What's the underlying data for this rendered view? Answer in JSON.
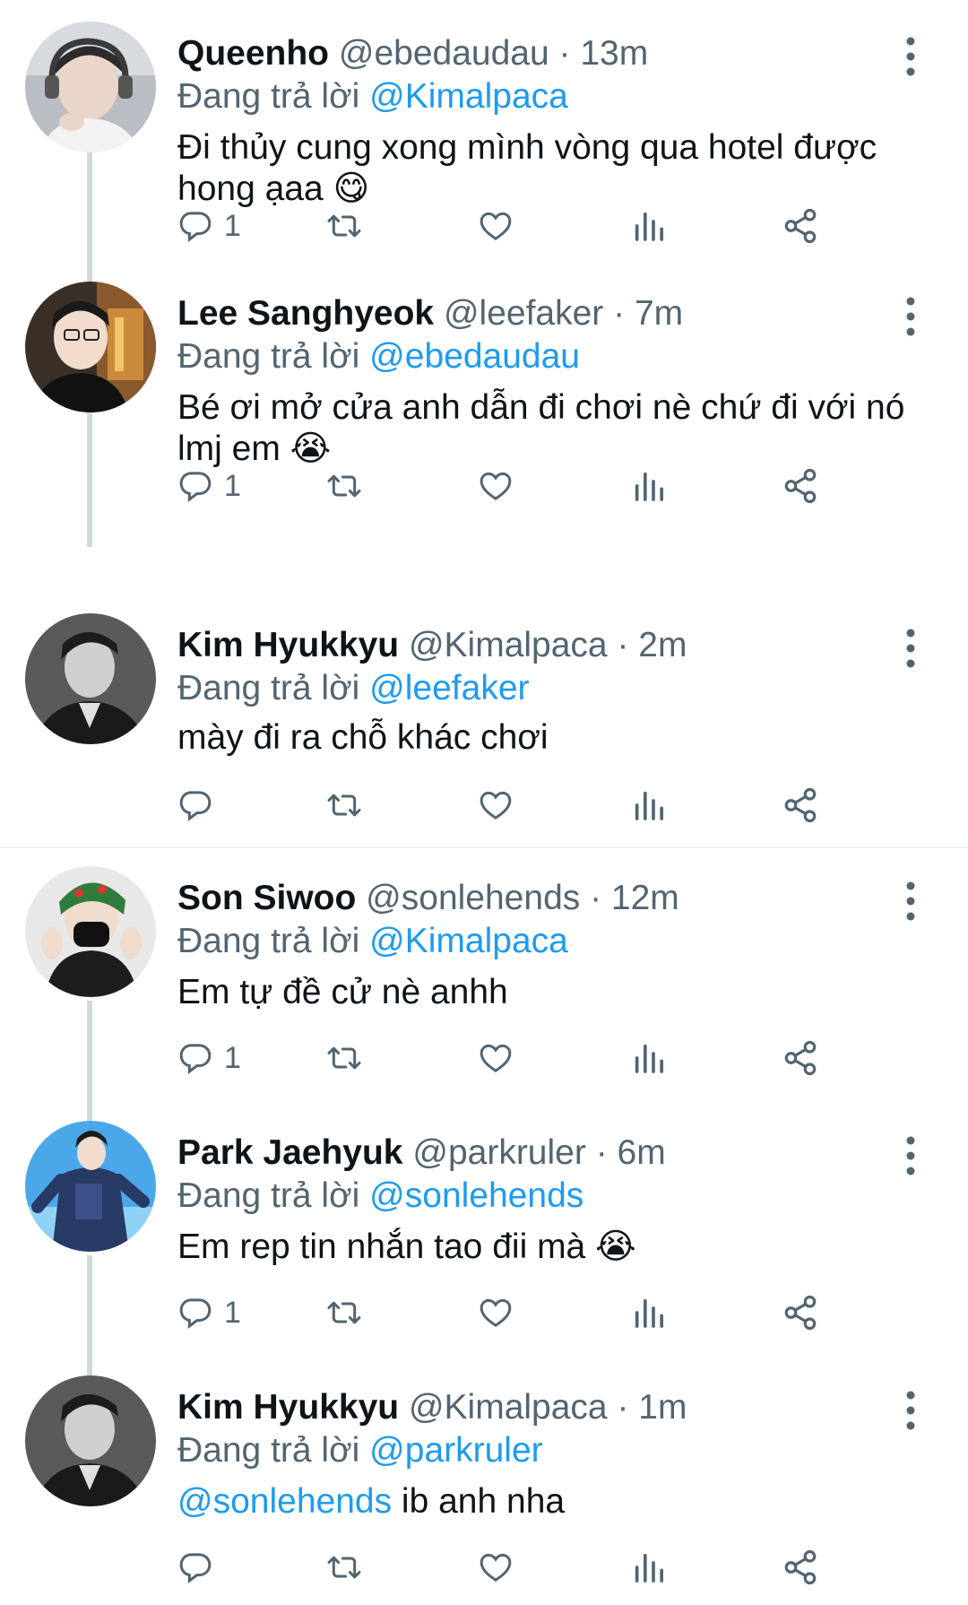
{
  "reply_prefix": "Đang trả lời",
  "tweets": [
    {
      "name": "Queenho",
      "handle": "@ebedaudau",
      "time": "· 13m",
      "reply_to": "@Kimalpaca",
      "text": "Đi thủy cung xong mình vòng qua hotel được hong ạaa 😋",
      "reply_count": "1"
    },
    {
      "name": "Lee Sanghyeok",
      "handle": "@leefaker",
      "time": "· 7m",
      "reply_to": "@ebedaudau",
      "text": "Bé ơi mở cửa anh dẫn đi chơi nè chứ đi với nó lmj em 😭",
      "reply_count": "1"
    },
    {
      "name": "Kim Hyukkyu",
      "handle": "@Kimalpaca",
      "time": "· 2m",
      "reply_to": "@leefaker",
      "text": "mày đi ra chỗ khác chơi",
      "reply_count": ""
    },
    {
      "name": "Son Siwoo",
      "handle": "@sonlehends",
      "time": "· 12m",
      "reply_to": "@Kimalpaca",
      "text": "Em tự đề cử nè anhh",
      "reply_count": "1"
    },
    {
      "name": "Park Jaehyuk",
      "handle": "@parkruler",
      "time": "· 6m",
      "reply_to": "@sonlehends",
      "text": "Em rep tin nhắn tao đii mà 😭",
      "reply_count": "1"
    },
    {
      "name": "Kim Hyukkyu",
      "handle": "@Kimalpaca",
      "time": "· 1m",
      "reply_to": "@parkruler",
      "text_mention": "@sonlehends",
      "text": " ib anh nha",
      "reply_count": ""
    }
  ],
  "icons": {
    "reply": "reply-icon",
    "retweet": "retweet-icon",
    "like": "heart-icon",
    "views": "views-icon",
    "share": "share-icon",
    "more": "more-vertical-icon"
  },
  "colors": {
    "accent": "#1d9bf0",
    "secondary_text": "#536471",
    "thread_line": "#cfd9de"
  }
}
